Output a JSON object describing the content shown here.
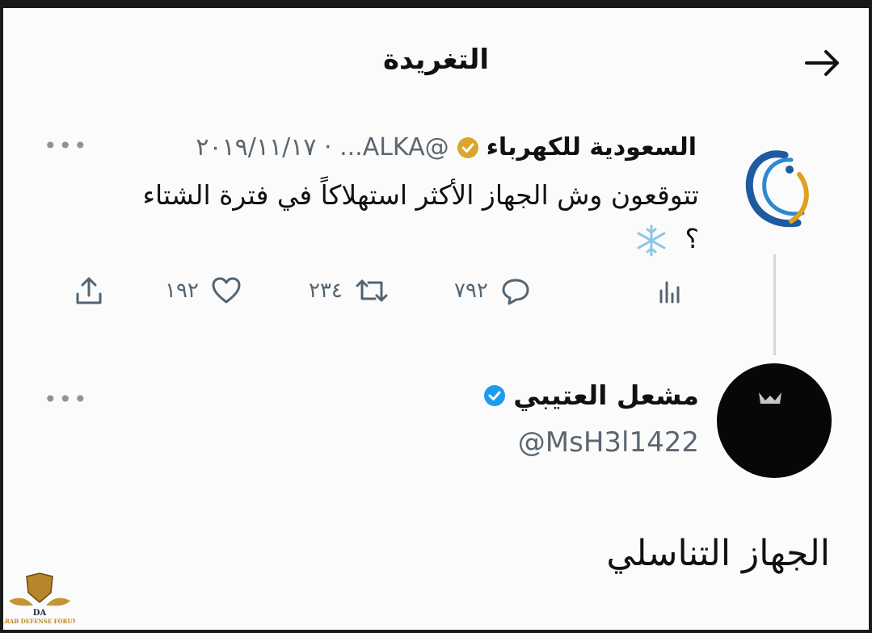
{
  "header": {
    "title": "التغريدة",
    "back_icon": "arrow-right-icon"
  },
  "tweet": {
    "author_name": "السعودية للكهرباء",
    "verified_badge": "gold-verified-badge-icon",
    "meta": "@ALKA... · ٢٠١٩/١١/١٧",
    "text": "تتوقعون وش الجهاز الأكثر استهلاكاً في فترة الشتاء ؟",
    "emoji_icon": "snowflake-icon",
    "stats": {
      "views_icon": "analytics-icon",
      "replies": "٧٩٢",
      "retweets": "٢٣٤",
      "likes": "١٩٢",
      "share_icon": "share-icon"
    }
  },
  "reply": {
    "author_name": "مشعل العتيبي",
    "verified_badge": "blue-verified-badge-icon",
    "handle": "@MsH3l1422",
    "text": "الجهاز التناسلي"
  },
  "watermark": {
    "text": "ARAB DEFENSE FORUM",
    "initials": "DA"
  },
  "colors": {
    "background": "#fbfbfb",
    "text": "#111111",
    "muted": "#536471",
    "gold_badge": "#d9a72b",
    "blue_badge": "#1d9bf0"
  }
}
